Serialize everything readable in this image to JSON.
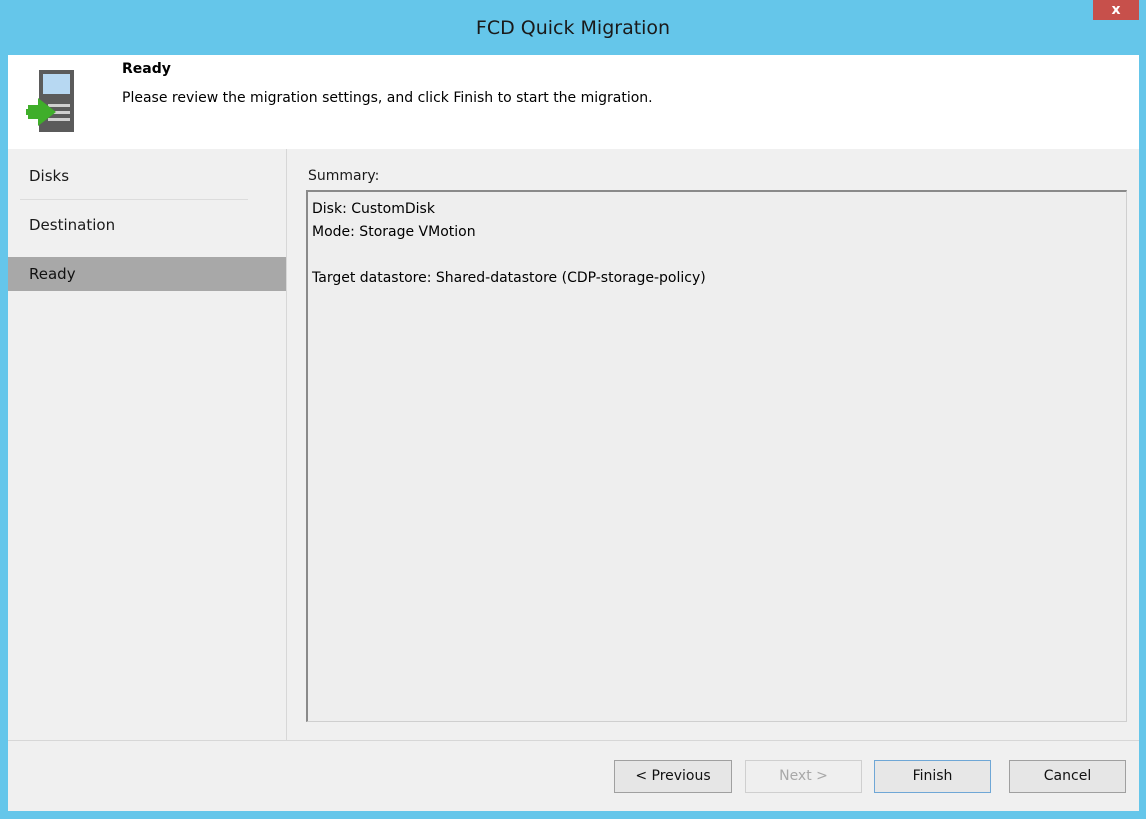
{
  "window": {
    "title": "FCD Quick Migration",
    "close_label": "x"
  },
  "header": {
    "title": "Ready",
    "description": "Please review the migration settings, and click Finish to start the migration."
  },
  "sidebar": {
    "items": [
      {
        "label": "Disks",
        "active": false
      },
      {
        "label": "Destination",
        "active": false
      },
      {
        "label": "Ready",
        "active": true
      }
    ]
  },
  "summary": {
    "label": "Summary:",
    "lines": [
      "Disk: CustomDisk",
      "Mode: Storage VMotion",
      "",
      "Target datastore: Shared-datastore (CDP-storage-policy)"
    ]
  },
  "buttons": {
    "previous": "< Previous",
    "next": "Next >",
    "finish": "Finish",
    "cancel": "Cancel"
  },
  "colors": {
    "titlebar": "#65c6ea",
    "close": "#c7504b",
    "active_nav": "#a8a8a8",
    "icon_green": "#3fae2a"
  }
}
